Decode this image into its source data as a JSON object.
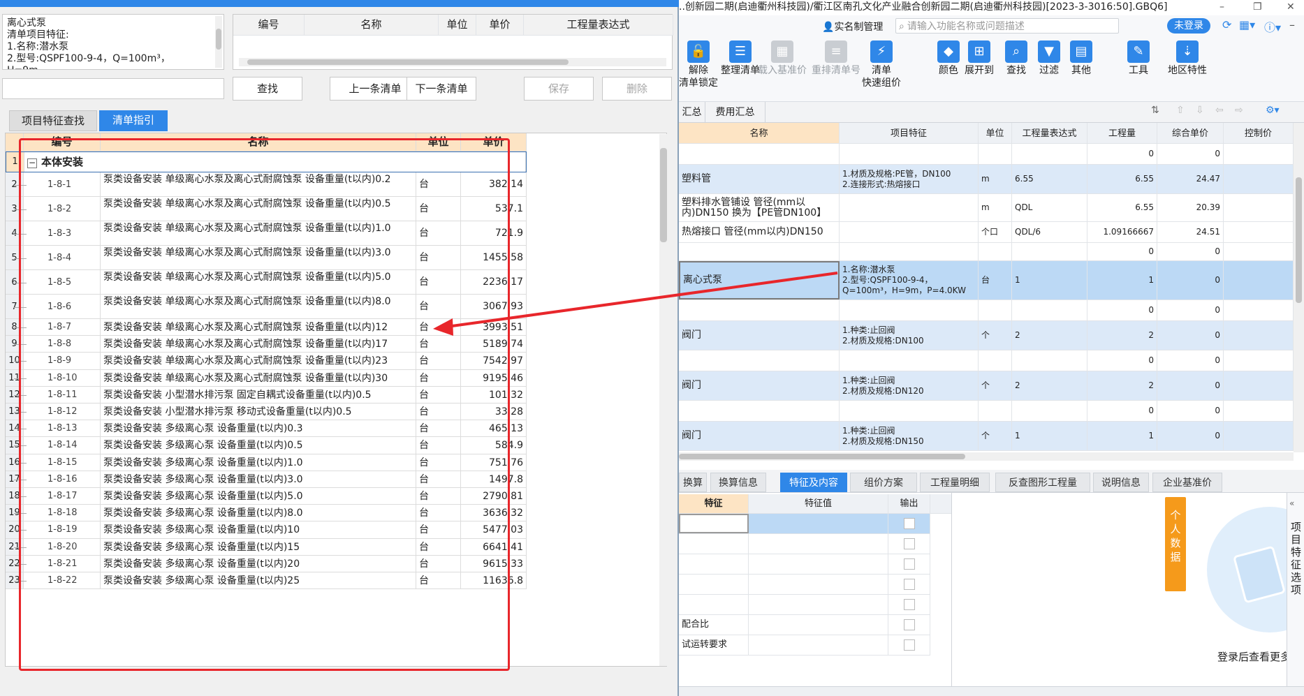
{
  "window": {
    "title": "..创新园二期(启迪衢州科技园)/衢江区南孔文化产业融合创新园二期(启迪衢州科技园)[2023-3-3016:50].GBQ6]",
    "min": "–",
    "restore": "❐",
    "close": "✕"
  },
  "header": {
    "realname": "实名制管理",
    "search_placeholder": "请输入功能名称或问题描述",
    "login": "未登录"
  },
  "toolbar": [
    {
      "label": "解除\n清单锁定",
      "icon": "🔓",
      "dis": false
    },
    {
      "label": "整理清单",
      "icon": "☰",
      "dis": false
    },
    {
      "label": "载入基准价",
      "icon": "▦",
      "dis": true
    },
    {
      "label": "重排清单号",
      "icon": "≡",
      "dis": true
    },
    {
      "label": "清单\n快速组价",
      "icon": "⚡",
      "dis": false
    },
    {
      "label": "颜色",
      "icon": "◆",
      "dis": false
    },
    {
      "label": "展开到",
      "icon": "⊞",
      "dis": false
    },
    {
      "label": "查找",
      "icon": "⌕",
      "dis": false
    },
    {
      "label": "过滤",
      "icon": "▼",
      "dis": false
    },
    {
      "label": "其他",
      "icon": "▤",
      "dis": false
    },
    {
      "label": "工具",
      "icon": "✎",
      "dis": false
    },
    {
      "label": "地区特性",
      "icon": "⇣",
      "dis": false
    }
  ],
  "rtabs": [
    "汇总",
    "费用汇总"
  ],
  "rgrid": {
    "headers": [
      "名称",
      "项目特征",
      "单位",
      "工程量表达式",
      "工程量",
      "综合单价",
      "控制价"
    ],
    "rows": [
      {
        "name": "",
        "feat": "",
        "unit": "",
        "expr": "",
        "qty": "0",
        "price": "0",
        "style": "w"
      },
      {
        "name": "塑料管",
        "feat": "1.材质及规格:PE管，DN100\n2.连接形式:热熔接口",
        "unit": "m",
        "expr": "6.55",
        "qty": "6.55",
        "price": "24.47",
        "style": "b"
      },
      {
        "name": "塑料排水管铺设 管径(mm以内)DN150 换为【PE管DN100】",
        "feat": "",
        "unit": "m",
        "expr": "QDL",
        "qty": "6.55",
        "price": "20.39",
        "style": "w"
      },
      {
        "name": "热熔接口 管径(mm以内)DN150",
        "feat": "",
        "unit": "个口",
        "expr": "QDL/6",
        "qty": "1.09166667",
        "price": "24.51",
        "style": "w"
      },
      {
        "name": "",
        "feat": "",
        "unit": "",
        "expr": "",
        "qty": "0",
        "price": "0",
        "style": "w"
      },
      {
        "name": "离心式泵",
        "feat": "1.名称:潜水泵\n2.型号:QSPF100-9-4，\nQ=100m³，H=9m，P=4.0KW",
        "unit": "台",
        "expr": "1",
        "qty": "1",
        "price": "0",
        "style": "s"
      },
      {
        "name": "",
        "feat": "",
        "unit": "",
        "expr": "",
        "qty": "0",
        "price": "0",
        "style": "w"
      },
      {
        "name": "阀门",
        "feat": "1.种类:止回阀\n2.材质及规格:DN100",
        "unit": "个",
        "expr": "2",
        "qty": "2",
        "price": "0",
        "style": "b"
      },
      {
        "name": "",
        "feat": "",
        "unit": "",
        "expr": "",
        "qty": "0",
        "price": "0",
        "style": "w"
      },
      {
        "name": "阀门",
        "feat": "1.种类:止回阀\n2.材质及规格:DN120",
        "unit": "个",
        "expr": "2",
        "qty": "2",
        "price": "0",
        "style": "b"
      },
      {
        "name": "",
        "feat": "",
        "unit": "",
        "expr": "",
        "qty": "0",
        "price": "0",
        "style": "w"
      },
      {
        "name": "阀门",
        "feat": "1.种类:止回阀\n2.材质及规格:DN150",
        "unit": "个",
        "expr": "1",
        "qty": "1",
        "price": "0",
        "style": "b"
      }
    ]
  },
  "btabs": [
    "换算",
    "换算信息",
    "特征及内容",
    "组价方案",
    "工程量明细",
    "反查图形工程量",
    "说明信息",
    "企业基准价"
  ],
  "feat_table": {
    "headers": [
      "特征",
      "特征值",
      "输出"
    ],
    "rows": [
      "",
      "",
      "",
      "",
      "",
      "配合比",
      "试运转要求"
    ]
  },
  "side": {
    "personal": "个\n人\n数\n据",
    "vertical": "项\n目\n特\n征\n选\n项",
    "login_hint": "登录后查看更多"
  },
  "left": {
    "desc": "离心式泵\n清单项目特征:\n1.名称:潜水泵\n2.型号:QSPF100-9-4，Q=100m³，H=9m，",
    "top_headers": [
      "编号",
      "名称",
      "单位",
      "单价",
      "工程量表达式"
    ],
    "btns": {
      "find": "查找",
      "prev": "上一条清单",
      "next": "下一条清单",
      "save": "保存",
      "del": "删除"
    },
    "tabs": [
      "项目特征查找",
      "清单指引"
    ],
    "grid_headers": [
      "编号",
      "名称",
      "单位",
      "单价"
    ],
    "group": "本体安装",
    "rows": [
      {
        "n": "2",
        "code": "1-8-1",
        "name": "泵类设备安装 单级离心水泵及离心式耐腐蚀泵 设备重量(t以内)0.2",
        "unit": "台",
        "price": "382.14"
      },
      {
        "n": "3",
        "code": "1-8-2",
        "name": "泵类设备安装 单级离心水泵及离心式耐腐蚀泵 设备重量(t以内)0.5",
        "unit": "台",
        "price": "537.1"
      },
      {
        "n": "4",
        "code": "1-8-3",
        "name": "泵类设备安装 单级离心水泵及离心式耐腐蚀泵 设备重量(t以内)1.0",
        "unit": "台",
        "price": "721.9"
      },
      {
        "n": "5",
        "code": "1-8-4",
        "name": "泵类设备安装 单级离心水泵及离心式耐腐蚀泵 设备重量(t以内)3.0",
        "unit": "台",
        "price": "1455.58"
      },
      {
        "n": "6",
        "code": "1-8-5",
        "name": "泵类设备安装 单级离心水泵及离心式耐腐蚀泵 设备重量(t以内)5.0",
        "unit": "台",
        "price": "2236.17"
      },
      {
        "n": "7",
        "code": "1-8-6",
        "name": "泵类设备安装 单级离心水泵及离心式耐腐蚀泵 设备重量(t以内)8.0",
        "unit": "台",
        "price": "3067.93"
      },
      {
        "n": "8",
        "code": "1-8-7",
        "name": "泵类设备安装 单级离心水泵及离心式耐腐蚀泵 设备重量(t以内)12",
        "unit": "台",
        "price": "3993.51"
      },
      {
        "n": "9",
        "code": "1-8-8",
        "name": "泵类设备安装 单级离心水泵及离心式耐腐蚀泵 设备重量(t以内)17",
        "unit": "台",
        "price": "5189.74"
      },
      {
        "n": "10",
        "code": "1-8-9",
        "name": "泵类设备安装 单级离心水泵及离心式耐腐蚀泵 设备重量(t以内)23",
        "unit": "台",
        "price": "7542.97"
      },
      {
        "n": "11",
        "code": "1-8-10",
        "name": "泵类设备安装 单级离心水泵及离心式耐腐蚀泵 设备重量(t以内)30",
        "unit": "台",
        "price": "9195.46"
      },
      {
        "n": "12",
        "code": "1-8-11",
        "name": "泵类设备安装 小型潜水排污泵 固定自耦式设备重量(t以内)0.5",
        "unit": "台",
        "price": "101.32"
      },
      {
        "n": "13",
        "code": "1-8-12",
        "name": "泵类设备安装 小型潜水排污泵 移动式设备重量(t以内)0.5",
        "unit": "台",
        "price": "33.28"
      },
      {
        "n": "14",
        "code": "1-8-13",
        "name": "泵类设备安装 多级离心泵 设备重量(t以内)0.3",
        "unit": "台",
        "price": "465.13"
      },
      {
        "n": "15",
        "code": "1-8-14",
        "name": "泵类设备安装 多级离心泵 设备重量(t以内)0.5",
        "unit": "台",
        "price": "584.9"
      },
      {
        "n": "16",
        "code": "1-8-15",
        "name": "泵类设备安装 多级离心泵 设备重量(t以内)1.0",
        "unit": "台",
        "price": "751.76"
      },
      {
        "n": "17",
        "code": "1-8-16",
        "name": "泵类设备安装 多级离心泵 设备重量(t以内)3.0",
        "unit": "台",
        "price": "1497.8"
      },
      {
        "n": "18",
        "code": "1-8-17",
        "name": "泵类设备安装 多级离心泵 设备重量(t以内)5.0",
        "unit": "台",
        "price": "2790.81"
      },
      {
        "n": "19",
        "code": "1-8-18",
        "name": "泵类设备安装 多级离心泵 设备重量(t以内)8.0",
        "unit": "台",
        "price": "3636.32"
      },
      {
        "n": "20",
        "code": "1-8-19",
        "name": "泵类设备安装 多级离心泵 设备重量(t以内)10",
        "unit": "台",
        "price": "5477.03"
      },
      {
        "n": "21",
        "code": "1-8-20",
        "name": "泵类设备安装 多级离心泵 设备重量(t以内)15",
        "unit": "台",
        "price": "6641.41"
      },
      {
        "n": "22",
        "code": "1-8-21",
        "name": "泵类设备安装 多级离心泵 设备重量(t以内)20",
        "unit": "台",
        "price": "9615.33"
      },
      {
        "n": "23",
        "code": "1-8-22",
        "name": "泵类设备安装 多级离心泵 设备重量(t以内)25",
        "unit": "台",
        "price": "11636.8"
      }
    ]
  },
  "colors": {
    "accent": "#2f87e8",
    "highlight": "#e8262b",
    "header": "#fde4c4"
  }
}
